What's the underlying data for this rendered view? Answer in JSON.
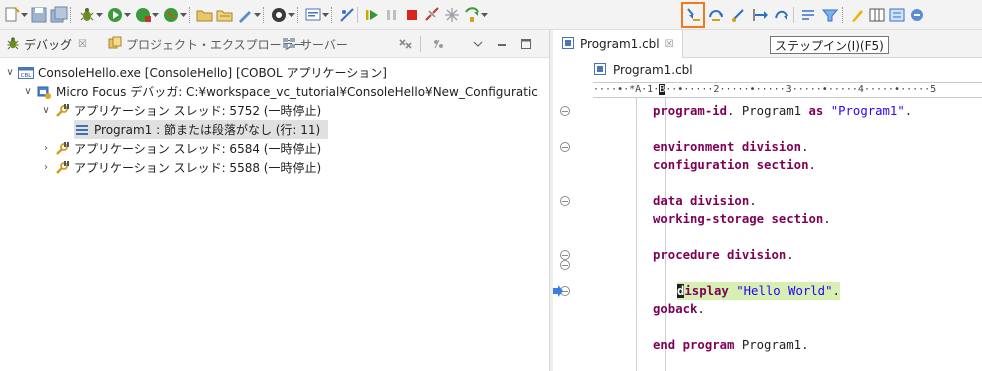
{
  "debug_view": {
    "tabs": [
      {
        "label": "デバッグ",
        "close": "☒",
        "active": true
      },
      {
        "label": "プロジェクト・エクスプローラー",
        "active": false
      },
      {
        "label": "サーバー",
        "active": false
      }
    ],
    "tree": [
      {
        "label": "ConsoleHello.exe [ConsoleHello] [COBOL アプリケーション]",
        "twisty": "∨"
      },
      {
        "label": "Micro Focus デバッガ: C:¥workspace_vc_tutorial¥ConsoleHello¥New_Configuratic",
        "twisty": "∨"
      },
      {
        "label": "アプリケーション スレッド: 5752 (一時停止)",
        "twisty": "∨"
      },
      {
        "label": "Program1 : 節または段落がなし (行: 11)",
        "twisty": ""
      },
      {
        "label": "アプリケーション スレッド: 6584 (一時停止)",
        "twisty": "›"
      },
      {
        "label": "アプリケーション スレッド: 5588 (一時停止)",
        "twisty": "›"
      }
    ]
  },
  "editor": {
    "tab_label": "Program1.cbl",
    "tab_close": "☒",
    "tooltip": "ステップイン(I)(F5)",
    "breadcrumb": "Program1.cbl",
    "ruler": {
      "before": "····•·*A·1·",
      "cursor": "B",
      "after": "··•·····2·····•·····3·····•·····4·····•·····5"
    },
    "code": [
      {
        "parts": [
          {
            "t": "program-id",
            "c": "kw"
          },
          {
            "t": ". Program1 ",
            "c": ""
          },
          {
            "t": "as",
            "c": "kw"
          },
          {
            "t": " ",
            "c": ""
          },
          {
            "t": "\"Program1\"",
            "c": "str"
          },
          {
            "t": ".",
            "c": ""
          }
        ]
      },
      {
        "parts": [
          {
            "t": "environment division",
            "c": "kw"
          },
          {
            "t": ".",
            "c": ""
          }
        ]
      },
      {
        "parts": [
          {
            "t": "configuration section",
            "c": "kw"
          },
          {
            "t": ".",
            "c": ""
          }
        ]
      },
      {
        "parts": [
          {
            "t": "data division",
            "c": "kw"
          },
          {
            "t": ".",
            "c": ""
          }
        ]
      },
      {
        "parts": [
          {
            "t": "working-storage section",
            "c": "kw"
          },
          {
            "t": ".",
            "c": ""
          }
        ]
      },
      {
        "parts": [
          {
            "t": "procedure division",
            "c": "kw"
          },
          {
            "t": ".",
            "c": ""
          }
        ]
      },
      {
        "parts": [
          {
            "t": "d",
            "c": "kw caret-char"
          },
          {
            "t": "isplay",
            "c": "kw"
          },
          {
            "t": " ",
            "c": ""
          },
          {
            "t": "\"Hello World\"",
            "c": "str"
          },
          {
            "t": ".",
            "c": ""
          }
        ],
        "current": true
      },
      {
        "parts": [
          {
            "t": "goback",
            "c": "kw"
          },
          {
            "t": ".",
            "c": ""
          }
        ]
      },
      {
        "parts": [
          {
            "t": "end program",
            "c": "kw"
          },
          {
            "t": " Program1.",
            "c": ""
          }
        ]
      }
    ]
  },
  "colors": {
    "highlight_box": "#ee7a1f",
    "keyword": "#7f0055",
    "string": "#2a00ff",
    "current_line": "#d6f0b4",
    "selected_row": "#e0e0e0"
  }
}
